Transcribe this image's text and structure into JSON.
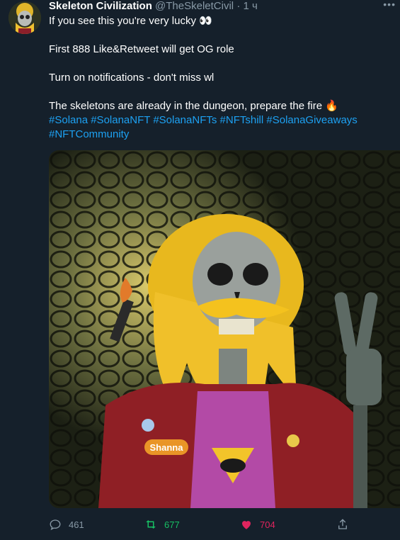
{
  "tweet": {
    "name": "Skeleton Civilization",
    "handle": "@TheSkeletCivil",
    "separator": "·",
    "time": "1 ч",
    "more_label": "•••",
    "line1": "If you see this  you're very lucky 👀",
    "line2": "First 888 Like&Retweet will get OG role",
    "line3": "Turn on notifications - don't miss wl",
    "line4": "The skeletons are already in the dungeon, prepare the fire 🔥",
    "hashtags_line1": "#Solana #SolanaNFT #SolanaNFTs #NFTshill #SolanaGiveaways",
    "hashtags_line2": "#NFTCommunity",
    "image_badge": "Shanna"
  },
  "actions": {
    "reply_count": "461",
    "retweet_count": "677",
    "like_count": "704"
  },
  "colors": {
    "background": "#15202b",
    "link": "#1da1f2",
    "retweet": "#17bf63",
    "like": "#e0245e",
    "muted": "#8899a6"
  }
}
